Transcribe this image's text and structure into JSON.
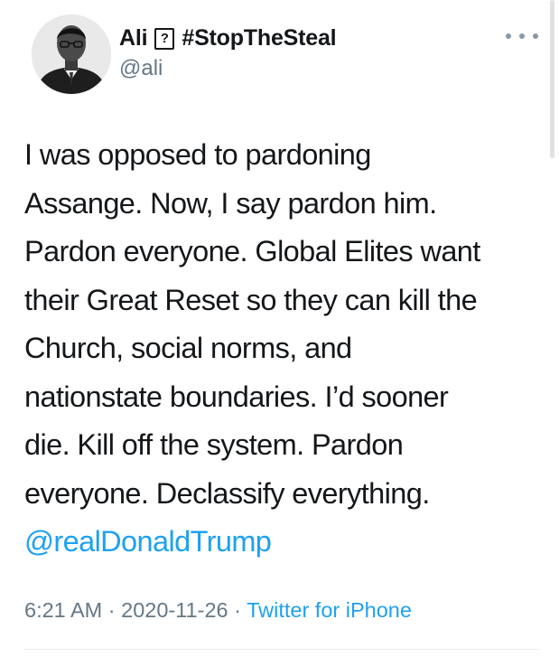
{
  "tweet": {
    "author": {
      "display_name": "Ali",
      "emoji_placeholder": "?",
      "hashtag": "#StopTheSteal",
      "handle": "@ali",
      "avatar_icon": "avatar-photo"
    },
    "more_icon": "more-dots-icon",
    "text_lines": [
      "I was opposed to pardoning",
      "Assange. Now, I say pardon him.",
      "Pardon everyone. Global Elites want",
      "their Great Reset so they can kill the",
      "Church, social norms, and",
      "nationstate boundaries. I’d sooner",
      "die. Kill off the system. Pardon",
      "everyone. Declassify everything."
    ],
    "mention": "@realDonaldTrump",
    "meta": {
      "time": "6:21 AM",
      "separator": " · ",
      "date": "2020-11-26",
      "source": "Twitter for iPhone"
    }
  },
  "colors": {
    "text": "#14171a",
    "secondary": "#657786",
    "link": "#1da1f2"
  }
}
